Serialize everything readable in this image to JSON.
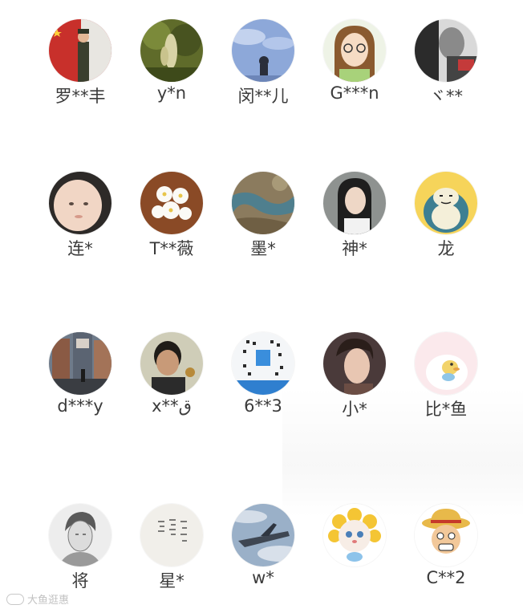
{
  "members": [
    {
      "name": "罗**丰",
      "avatar_icon": "soldier-flag-avatar"
    },
    {
      "name": "y*n",
      "avatar_icon": "green-plant-avatar"
    },
    {
      "name": "闵**儿",
      "avatar_icon": "blue-sky-figure-avatar"
    },
    {
      "name": "G***n",
      "avatar_icon": "cartoon-girl-glasses-avatar"
    },
    {
      "name": "ヾ**",
      "avatar_icon": "monochrome-photo-avatar"
    },
    {
      "name": "连*",
      "avatar_icon": "baby-face-avatar"
    },
    {
      "name": "T**薇",
      "avatar_icon": "white-flowers-avatar"
    },
    {
      "name": "墨*",
      "avatar_icon": "aerial-landscape-avatar"
    },
    {
      "name": "神*",
      "avatar_icon": "person-selfie-avatar"
    },
    {
      "name": "龙",
      "avatar_icon": "snorlax-avatar"
    },
    {
      "name": "d***y",
      "avatar_icon": "city-street-avatar"
    },
    {
      "name": "x**ق",
      "avatar_icon": "young-man-avatar"
    },
    {
      "name": "6**3",
      "avatar_icon": "qr-code-service-avatar"
    },
    {
      "name": "小*",
      "avatar_icon": "illustrated-man-avatar"
    },
    {
      "name": "比*鱼",
      "avatar_icon": "cute-bird-pink-avatar"
    },
    {
      "name": "将",
      "avatar_icon": "sketch-portrait-avatar"
    },
    {
      "name": "星*",
      "avatar_icon": "handwritten-note-avatar"
    },
    {
      "name": "w*",
      "avatar_icon": "airplane-sky-avatar"
    },
    {
      "name": "",
      "avatar_icon": "cat-sunflower-avatar"
    },
    {
      "name": "C**2",
      "avatar_icon": "luffy-cartoon-avatar"
    }
  ],
  "watermark": {
    "text": "大鱼逛惠"
  }
}
